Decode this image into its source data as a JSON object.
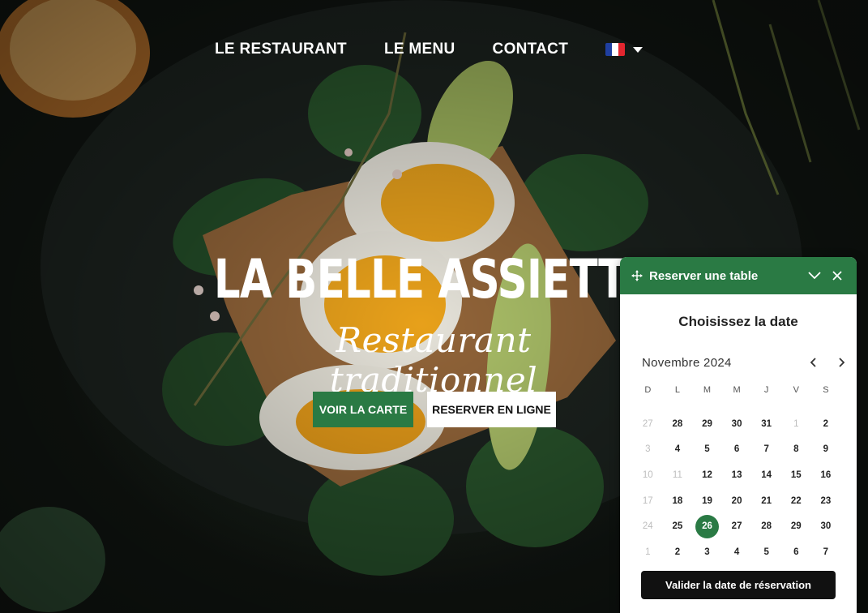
{
  "nav": {
    "items": [
      {
        "label": "LE RESTAURANT"
      },
      {
        "label": "LE MENU"
      },
      {
        "label": "CONTACT"
      }
    ],
    "language": {
      "icon": "france-flag-icon",
      "colors": [
        "#1f3fa0",
        "#ffffff",
        "#e3262f"
      ]
    }
  },
  "hero": {
    "title": "LA BELLE ASSIETTE",
    "subtitle": "Restaurant traditionnel",
    "btn_menu": "VOIR LA CARTE",
    "btn_reserve": "RESERVER  EN LIGNE"
  },
  "widget": {
    "header": "Reserver une table",
    "title": "Choisissez la date",
    "month": "Novembre 2024",
    "weekdays": [
      "D",
      "L",
      "M",
      "M",
      "J",
      "V",
      "S"
    ],
    "days": [
      {
        "n": "27",
        "muted": true
      },
      {
        "n": "28"
      },
      {
        "n": "29"
      },
      {
        "n": "30"
      },
      {
        "n": "31"
      },
      {
        "n": "1",
        "muted": true
      },
      {
        "n": "2"
      },
      {
        "n": "3",
        "muted": true
      },
      {
        "n": "4"
      },
      {
        "n": "5"
      },
      {
        "n": "6"
      },
      {
        "n": "7"
      },
      {
        "n": "8"
      },
      {
        "n": "9"
      },
      {
        "n": "10",
        "muted": true
      },
      {
        "n": "11",
        "muted": true
      },
      {
        "n": "12"
      },
      {
        "n": "13"
      },
      {
        "n": "14"
      },
      {
        "n": "15"
      },
      {
        "n": "16"
      },
      {
        "n": "17",
        "muted": true
      },
      {
        "n": "18"
      },
      {
        "n": "19"
      },
      {
        "n": "20"
      },
      {
        "n": "21"
      },
      {
        "n": "22"
      },
      {
        "n": "23"
      },
      {
        "n": "24",
        "muted": true
      },
      {
        "n": "25"
      },
      {
        "n": "26",
        "selected": true
      },
      {
        "n": "27"
      },
      {
        "n": "28"
      },
      {
        "n": "29"
      },
      {
        "n": "30"
      },
      {
        "n": "1",
        "muted": true
      },
      {
        "n": "2"
      },
      {
        "n": "3"
      },
      {
        "n": "4"
      },
      {
        "n": "5"
      },
      {
        "n": "6"
      },
      {
        "n": "7"
      }
    ],
    "validate": "Valider la date de réservation"
  },
  "colors": {
    "accent": "#2a7a44",
    "dark": "#111111"
  }
}
